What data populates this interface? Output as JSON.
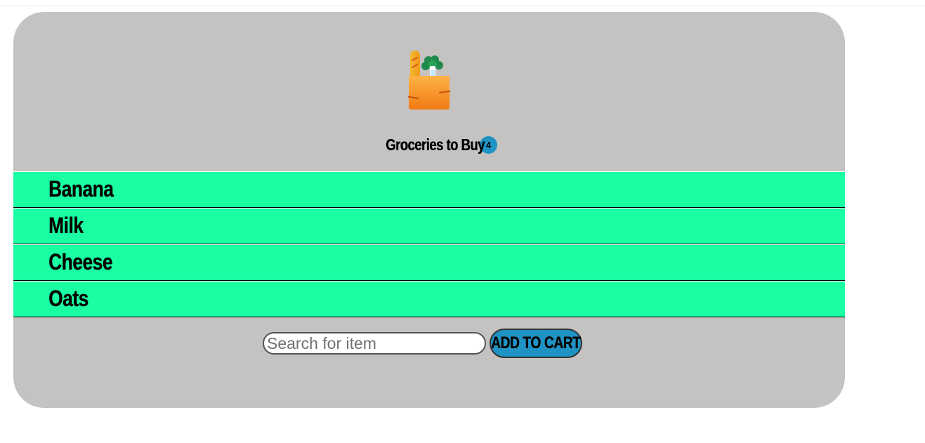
{
  "header": {
    "icon": "grocery-bag-icon",
    "title": "Groceries to Buy",
    "count": "4"
  },
  "items": [
    {
      "label": "Banana"
    },
    {
      "label": "Milk"
    },
    {
      "label": "Cheese"
    },
    {
      "label": "Oats"
    }
  ],
  "form": {
    "search_placeholder": "Search for item",
    "search_value": "",
    "add_button_label": "ADD TO CART"
  },
  "colors": {
    "card_background": "#c4c3c1",
    "item_background": "#19ffa1",
    "accent": "#1f93c4"
  }
}
